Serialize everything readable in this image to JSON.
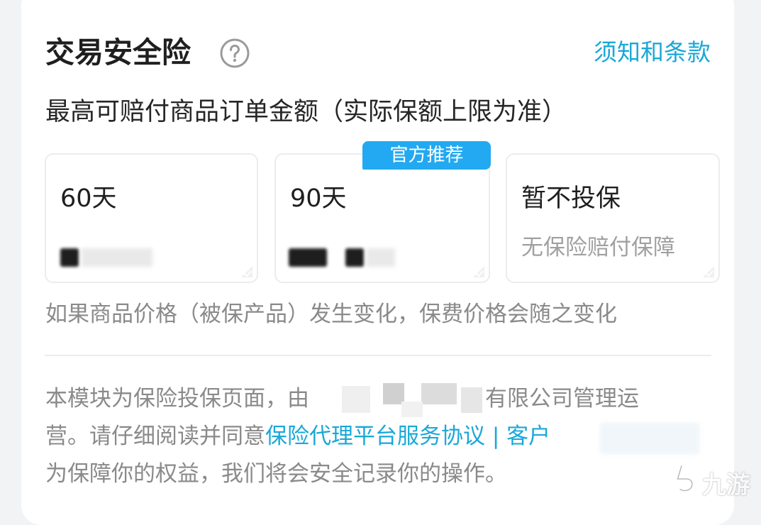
{
  "header": {
    "title": "交易安全险",
    "terms_link": "须知和条款"
  },
  "subtitle": "最高可赔付商品订单金额（实际保额上限为准）",
  "options": [
    {
      "title": "60天",
      "desc": "",
      "selected": false
    },
    {
      "title": "90天",
      "desc": "",
      "selected": false
    },
    {
      "title": "暂不投保",
      "desc": "无保险赔付保障",
      "selected": false
    }
  ],
  "badge": "官方推荐",
  "note": "如果商品价格（被保产品）发生变化，保费价格会随之变化",
  "footer": {
    "line1_a": "本模块为保险投保页面，由",
    "line1_b": "有限公司管理运",
    "line2_a": "营。请仔细阅读并同意",
    "line2_link": "保险代理平台服务协议",
    "line2_sep": " | ",
    "line2_link2": "客户",
    "line3": "为保障你的权益，我们将会安全记录你的操作。"
  },
  "watermark": "九游",
  "colors": {
    "accent": "#1aa8d8",
    "badge": "#22a9f1",
    "text_primary": "#1f1f1f",
    "text_secondary": "#8a8a8a"
  }
}
